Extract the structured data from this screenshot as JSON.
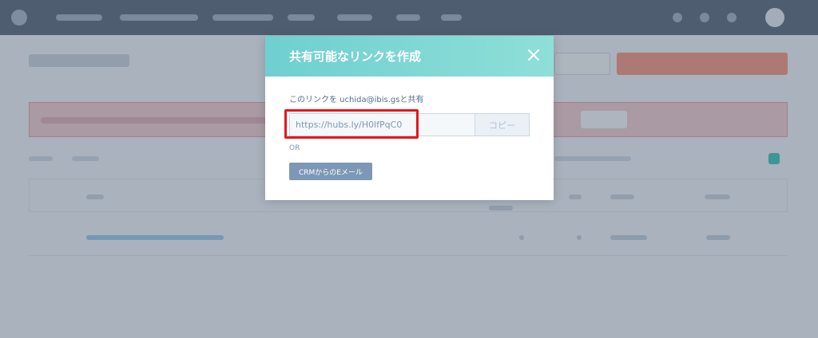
{
  "modal": {
    "title": "共有可能なリンクを作成",
    "share_label": "このリンクを uchida@ibis.gsと共有",
    "link_value": "https://hubs.ly/H0lfPqC0",
    "copy_label": "コピー",
    "or_label": "OR",
    "crm_email_label": "CRMからのEメール",
    "close_icon": "close-icon"
  },
  "colors": {
    "header_gradient_start": "#6fcfd0",
    "header_gradient_end": "#8fdfd8",
    "highlight": "#e8151b",
    "secondary_button": "#7c98b6",
    "nav_background": "#2d3e50"
  }
}
